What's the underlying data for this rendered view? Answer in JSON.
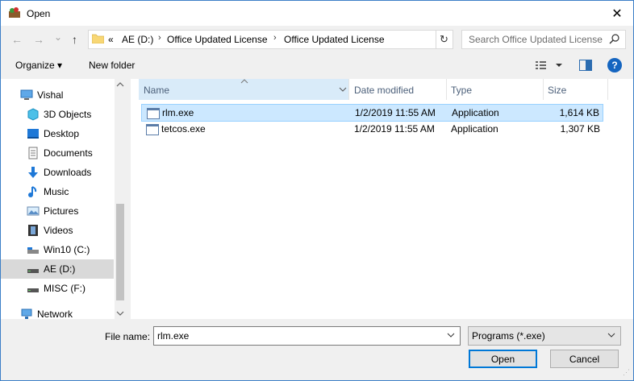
{
  "window": {
    "title": "Open",
    "close_glyph": "✕"
  },
  "nav": {
    "back_glyph": "←",
    "forward_glyph": "→",
    "recent_glyph": "⌄",
    "up_glyph": "↑",
    "crumbs": [
      {
        "label": "«"
      },
      {
        "label": "AE (D:)"
      },
      {
        "label": "Office Updated License"
      },
      {
        "label": "Office Updated License"
      }
    ],
    "crumb_sep": "›",
    "refresh_glyph": "↻",
    "search_placeholder": "Search Office Updated License"
  },
  "toolbar": {
    "organize_label": "Organize ▾",
    "new_folder_label": "New folder",
    "help_glyph": "?"
  },
  "sidebar": {
    "items": [
      {
        "label": "Vishal",
        "icon": "computer-icon"
      },
      {
        "label": "3D Objects",
        "icon": "cube-icon"
      },
      {
        "label": "Desktop",
        "icon": "desktop-icon"
      },
      {
        "label": "Documents",
        "icon": "documents-icon"
      },
      {
        "label": "Downloads",
        "icon": "download-icon"
      },
      {
        "label": "Music",
        "icon": "music-icon"
      },
      {
        "label": "Pictures",
        "icon": "pictures-icon"
      },
      {
        "label": "Videos",
        "icon": "videos-icon"
      },
      {
        "label": "Win10 (C:)",
        "icon": "drive-icon"
      },
      {
        "label": "AE (D:)",
        "icon": "drive-icon",
        "selected": true
      },
      {
        "label": "MISC (F:)",
        "icon": "drive-icon"
      },
      {
        "label": "Network",
        "icon": "network-icon"
      }
    ]
  },
  "filelist": {
    "columns": [
      "Name",
      "Date modified",
      "Type",
      "Size"
    ],
    "rows": [
      {
        "name": "rlm.exe",
        "date": "1/2/2019 11:55 AM",
        "type": "Application",
        "size": "1,614 KB",
        "selected": true
      },
      {
        "name": "tetcos.exe",
        "date": "1/2/2019 11:55 AM",
        "type": "Application",
        "size": "1,307 KB",
        "selected": false
      }
    ]
  },
  "footer": {
    "filename_label": "File name:",
    "filename_value": "rlm.exe",
    "filetype_value": "Programs (*.exe)",
    "open_label": "Open",
    "cancel_label": "Cancel"
  },
  "colors": {
    "accent": "#0078d7",
    "selection": "#cce8ff",
    "help": "#1565c0"
  }
}
